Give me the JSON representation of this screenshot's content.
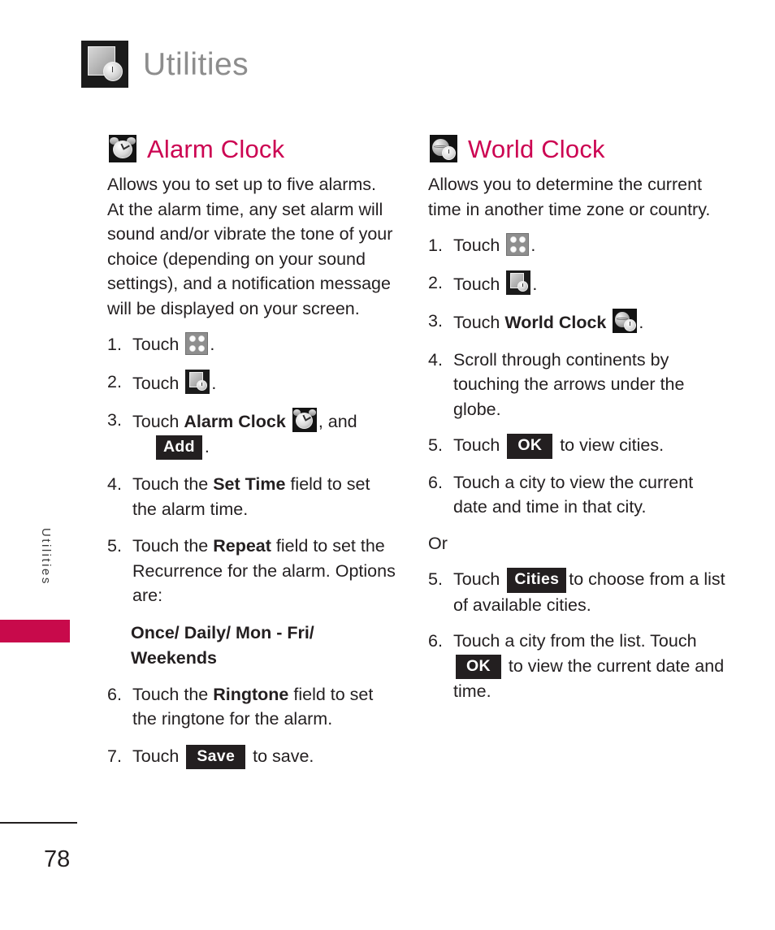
{
  "header": {
    "title": "Utilities",
    "icon": "utilities-icon"
  },
  "side_tab": {
    "label": "Utilities",
    "marker_color": "#c80a4b"
  },
  "footer": {
    "page_number": "78"
  },
  "accent_color": "#cc0452",
  "left_column": {
    "heading": "Alarm Clock",
    "heading_icon": "alarm-clock-icon",
    "intro": "Allows you to set up to five alarms. At the alarm time, any set alarm will sound and/or vibrate the tone of your choice (depending on your sound settings), and a notification message will be displayed on your screen.",
    "steps": [
      {
        "num": "1.",
        "text_before": "Touch",
        "icon": "grid-menu-icon",
        "text_after": "."
      },
      {
        "num": "2.",
        "text_before": "Touch",
        "icon": "utilities-icon",
        "text_after": "."
      },
      {
        "num": "3.",
        "text_before": "Touch",
        "keyword": "Alarm Clock",
        "icon": "alarm-clock-icon",
        "text_mid": ", and",
        "button": "Add",
        "text_after": "."
      },
      {
        "num": "4.",
        "text_before": "Touch the",
        "keyword": "Set Time",
        "text_after": "field to set the alarm time."
      },
      {
        "num": "5.",
        "text_before": "Touch the",
        "keyword": "Repeat",
        "text_after": "field to set the Recurrence for the alarm. Options are:"
      },
      {
        "num": "6.",
        "text_before": "Touch the",
        "keyword": "Ringtone",
        "text_after": "field to set the ringtone for the alarm."
      },
      {
        "num": "7.",
        "text_before": "Touch",
        "button": "Save",
        "text_after": "to save."
      }
    ],
    "options_line": "Once/ Daily/ Mon - Fri/ Weekends"
  },
  "right_column": {
    "heading": "World Clock",
    "heading_icon": "world-clock-icon",
    "intro": "Allows you to determine the current time in another time zone or country.",
    "steps": [
      {
        "num": "1.",
        "text_before": "Touch",
        "icon": "grid-menu-icon",
        "text_after": "."
      },
      {
        "num": "2.",
        "text_before": "Touch",
        "icon": "utilities-icon",
        "text_after": "."
      },
      {
        "num": "3.",
        "text_before": "Touch",
        "keyword": "World Clock",
        "icon": "world-clock-icon",
        "text_after": "."
      },
      {
        "num": "4.",
        "text_before": "Scroll through continents by touching the arrows under the globe."
      },
      {
        "num": "5.",
        "text_before": "Touch",
        "button": "OK",
        "text_after": "to view cities."
      },
      {
        "num": "6.",
        "text_before": "Touch a city to view the current date and time in that city."
      }
    ],
    "or_label": "Or",
    "alt_steps": [
      {
        "num": "5.",
        "text_before": "Touch",
        "button": "Cities",
        "text_after": "to choose from a list of available cities."
      },
      {
        "num": "6.",
        "text_before": "Touch a city from the list. Touch",
        "button": "OK",
        "text_after": "to view the current date and time."
      }
    ]
  }
}
